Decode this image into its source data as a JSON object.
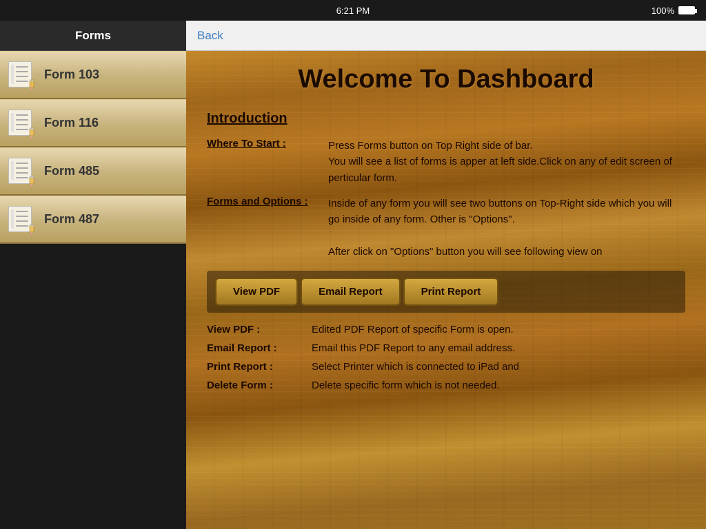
{
  "statusBar": {
    "time": "6:21 PM",
    "battery": "100%"
  },
  "sidebar": {
    "title": "Forms",
    "items": [
      {
        "id": "form-103",
        "label": "Form 103"
      },
      {
        "id": "form-116",
        "label": "Form 116"
      },
      {
        "id": "form-485",
        "label": "Form 485"
      },
      {
        "id": "form-487",
        "label": "Form 487"
      }
    ]
  },
  "navBar": {
    "backLabel": "Back"
  },
  "main": {
    "title": "Welcome To Dashboard",
    "intro": {
      "heading": "Introduction",
      "rows": [
        {
          "label": "Where To Start :",
          "text": "Press Forms button on Top Right side of bar.\nYou will see a list of forms is apper at left side.Click on any of edit screen of perticular form."
        },
        {
          "label": "Forms and Options :",
          "text": "Inside of any form you will see two buttons on Top-Right side which you will go inside of any form. Other is \"Options\".\n\nAfter click on \"Options\" button you will see following view on"
        }
      ]
    },
    "optionsBar": {
      "buttons": [
        "View PDF",
        "Email Report",
        "Print Report"
      ]
    },
    "descriptions": [
      {
        "key": "View PDF :",
        "value": "Edited PDF Report of specific Form is open."
      },
      {
        "key": "Email Report :",
        "value": "Email this PDF Report to any email address."
      },
      {
        "key": "Print Report :",
        "value": "Select Printer which is connected to iPad and"
      },
      {
        "key": "Delete Form :",
        "value": "Delete specific form which is not needed."
      }
    ]
  }
}
